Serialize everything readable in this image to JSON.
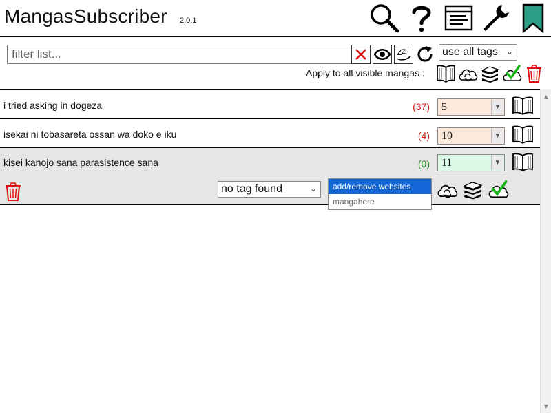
{
  "app": {
    "title": "MangasSubscriber",
    "version": "2.0.1"
  },
  "header_icons": [
    "search-icon",
    "help-icon",
    "list-icon",
    "wrench-icon",
    "bookmark-icon"
  ],
  "filter": {
    "placeholder": "filter list...",
    "value": ""
  },
  "tags_filter": {
    "selected": "use all tags"
  },
  "apply": {
    "label": "Apply to all visible mangas :"
  },
  "mangas": [
    {
      "title": "i tried asking in dogeza",
      "count": "(37)",
      "chapter": "5"
    },
    {
      "title": "isekai ni tobasareta ossan wa doko e iku",
      "count": "(4)",
      "chapter": "10"
    },
    {
      "title": "kisei kanojo sana parasistence sana",
      "count": "(0)",
      "chapter": "11"
    }
  ],
  "expanded": {
    "tag_selected": "no tag found",
    "websites": [
      {
        "label": "add/remove websites",
        "selected": true
      },
      {
        "label": "mangahere",
        "selected": false
      }
    ]
  },
  "colors": {
    "count_new": "#d11a1a",
    "count_none": "#1a8a1a",
    "chapter_unread": "#fde8dc",
    "chapter_read": "#dcf8e6",
    "select_highlight": "#1266d6",
    "bookmark": "#2a9d84",
    "trash": "#e11010"
  }
}
